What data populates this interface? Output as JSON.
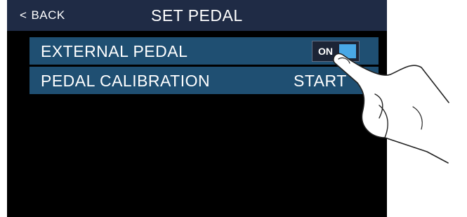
{
  "header": {
    "back_label": "BACK",
    "title": "SET PEDAL"
  },
  "rows": [
    {
      "label": "EXTERNAL PEDAL",
      "toggle_text": "ON"
    },
    {
      "label": "PEDAL CALIBRATION",
      "action_label": "START"
    }
  ],
  "colors": {
    "header_bg": "#1f2b45",
    "row_bg": "#1f4f72",
    "toggle_on": "#49a8e6"
  },
  "icons": {
    "back": "chevron-left-icon",
    "hand": "pointing-hand-icon"
  }
}
